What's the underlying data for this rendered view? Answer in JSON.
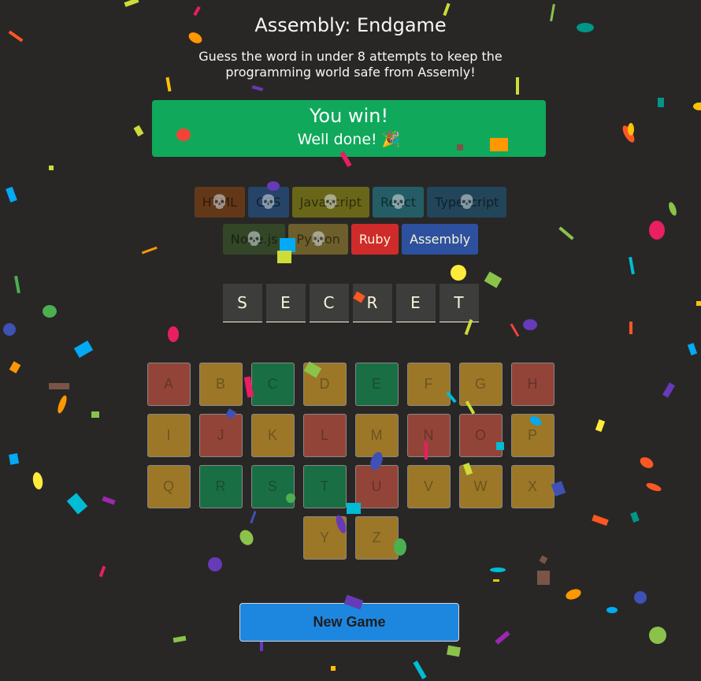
{
  "header": {
    "title": "Assembly: Endgame",
    "subtitle": "Guess the word in under 8 attempts to keep the programming world safe from Assemly!"
  },
  "status": {
    "title": "You win!",
    "message": "Well done! 🎉"
  },
  "languages": [
    {
      "name": "HTML",
      "bg": "#E2680F",
      "fg": "#F9F4DA",
      "lost": true
    },
    {
      "name": "CSS",
      "bg": "#328AF1",
      "fg": "#F9F4DA",
      "lost": true
    },
    {
      "name": "Javascript",
      "bg": "#F4EB13",
      "fg": "#1E1E1E",
      "lost": true
    },
    {
      "name": "React",
      "bg": "#2ED3E9",
      "fg": "#1E1E1E",
      "lost": true
    },
    {
      "name": "Typescript",
      "bg": "#298EC6",
      "fg": "#F9F4DA",
      "lost": true
    },
    {
      "name": "Node.js",
      "bg": "#599137",
      "fg": "#F9F4DA",
      "lost": true
    },
    {
      "name": "Python",
      "bg": "#FFD742",
      "fg": "#1E1E1E",
      "lost": true
    },
    {
      "name": "Ruby",
      "bg": "#D02B2B",
      "fg": "#F9F4DA",
      "lost": false
    },
    {
      "name": "Assembly",
      "bg": "#2D519F",
      "fg": "#F9F4DA",
      "lost": false
    }
  ],
  "skull_icon": "💀",
  "word": [
    "S",
    "E",
    "C",
    "R",
    "E",
    "T"
  ],
  "keyboard": [
    {
      "k": "A",
      "s": "wrong"
    },
    {
      "k": "B",
      "s": "unused"
    },
    {
      "k": "C",
      "s": "correct"
    },
    {
      "k": "D",
      "s": "unused"
    },
    {
      "k": "E",
      "s": "correct"
    },
    {
      "k": "F",
      "s": "unused"
    },
    {
      "k": "G",
      "s": "unused"
    },
    {
      "k": "H",
      "s": "wrong"
    },
    {
      "k": "I",
      "s": "unused"
    },
    {
      "k": "J",
      "s": "wrong"
    },
    {
      "k": "K",
      "s": "unused"
    },
    {
      "k": "L",
      "s": "wrong"
    },
    {
      "k": "M",
      "s": "unused"
    },
    {
      "k": "N",
      "s": "wrong"
    },
    {
      "k": "O",
      "s": "wrong"
    },
    {
      "k": "P",
      "s": "unused"
    },
    {
      "k": "Q",
      "s": "unused"
    },
    {
      "k": "R",
      "s": "correct"
    },
    {
      "k": "S",
      "s": "correct"
    },
    {
      "k": "T",
      "s": "correct"
    },
    {
      "k": "U",
      "s": "wrong"
    },
    {
      "k": "V",
      "s": "unused"
    },
    {
      "k": "W",
      "s": "unused"
    },
    {
      "k": "X",
      "s": "unused"
    },
    {
      "k": "Y",
      "s": "unused"
    },
    {
      "k": "Z",
      "s": "unused"
    }
  ],
  "new_game_label": "New Game",
  "colors": {
    "background": "#282726",
    "win": "#10A95B",
    "button": "#1D87E0"
  }
}
